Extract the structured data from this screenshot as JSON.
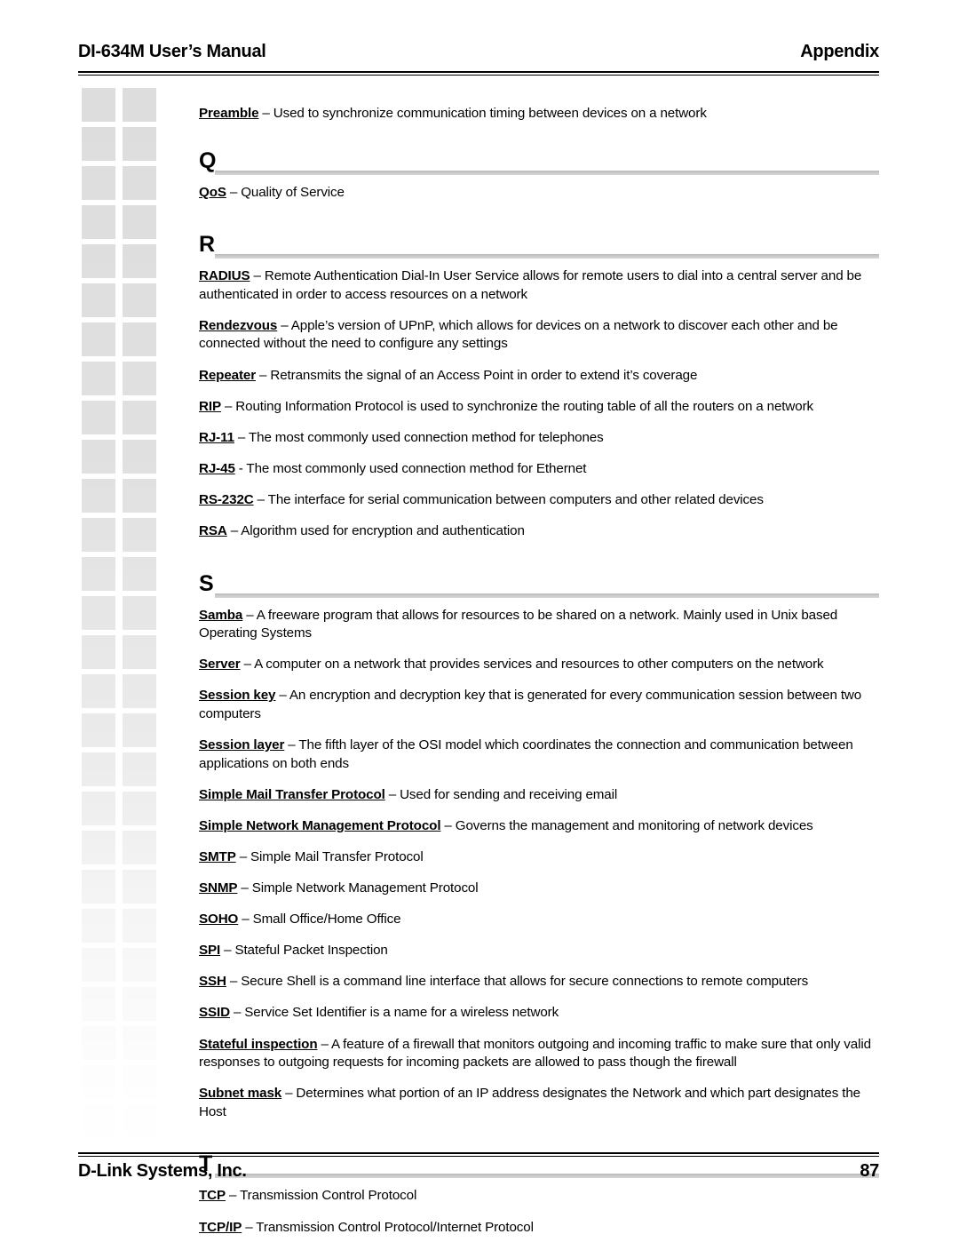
{
  "header": {
    "manual_title": "DI-634M User’s Manual",
    "section_label": "Appendix"
  },
  "footer": {
    "company": "D-Link Systems, Inc.",
    "page_number": "87"
  },
  "decoration": {
    "square_color": "#dddddd",
    "columns": 2,
    "rows": 27
  },
  "glossary": {
    "intro_entries": [
      {
        "term": "Preamble",
        "definition": " – Used to synchronize communication timing between devices on a network"
      }
    ],
    "sections": [
      {
        "letter": "Q",
        "entries": [
          {
            "term": "QoS",
            "definition": " – Quality of Service"
          }
        ]
      },
      {
        "letter": "R",
        "entries": [
          {
            "term": "RADIUS",
            "definition": " – Remote Authentication Dial-In User Service allows for remote users to dial into a central server and be authenticated in order to access resources on a network"
          },
          {
            "term": "Rendezvous",
            "definition": " – Apple’s version of UPnP, which allows for devices on a network to discover each other and be connected without the need to configure any settings"
          },
          {
            "term": "Repeater",
            "definition": " – Retransmits the signal of an Access Point in order to extend it’s coverage"
          },
          {
            "term": "RIP",
            "definition": " – Routing Information Protocol is used to synchronize the routing table of all the routers on a network"
          },
          {
            "term": "RJ-11",
            "definition": " – The most commonly used connection method for telephones"
          },
          {
            "term": "RJ-45",
            "definition": " - The most commonly used connection method for Ethernet"
          },
          {
            "term": "RS-232C",
            "definition": " – The interface for serial communication between computers and other related devices"
          },
          {
            "term": "RSA",
            "definition": " – Algorithm used for encryption and authentication"
          }
        ]
      },
      {
        "letter": "S",
        "entries": [
          {
            "term": "Samba",
            "definition": " – A freeware program that allows for resources to be shared on a network.  Mainly used in Unix based Operating Systems"
          },
          {
            "term": "Server",
            "definition": " – A computer on a network that provides services and resources to other computers on the network"
          },
          {
            "term": "Session key",
            "definition": " – An encryption and decryption key that is generated for every communication session between two computers"
          },
          {
            "term": "Session layer",
            "definition": " – The fifth layer of the OSI model which coordinates the connection and communication between applications on both ends"
          },
          {
            "term": "Simple Mail Transfer Protocol",
            "definition": " – Used for sending and receiving email"
          },
          {
            "term": "Simple Network Management Protocol",
            "definition": " – Governs the management and monitoring of network devices"
          },
          {
            "term": "SMTP",
            "definition": " – Simple Mail Transfer Protocol"
          },
          {
            "term": "SNMP",
            "definition": " – Simple Network Management Protocol"
          },
          {
            "term": "SOHO",
            "definition": " – Small Office/Home Office"
          },
          {
            "term": "SPI",
            "definition": " – Stateful Packet Inspection"
          },
          {
            "term": "SSH",
            "definition": " – Secure Shell is a command line interface that allows for secure connections to remote computers"
          },
          {
            "term": "SSID",
            "definition": " – Service Set Identifier is a name for a wireless network"
          },
          {
            "term": "Stateful inspection",
            "definition": " – A feature of a firewall that monitors outgoing and incoming traffic to make sure that only valid responses to outgoing requests for incoming packets are allowed to pass though the firewall"
          },
          {
            "term": "Subnet mask",
            "definition": " – Determines what portion of an IP address designates the Network and which part designates the Host"
          }
        ]
      },
      {
        "letter": "T",
        "entries": [
          {
            "term": "TCP",
            "definition": " – Transmission Control Protocol"
          },
          {
            "term": "TCP/IP",
            "definition": " – Transmission Control Protocol/Internet Protocol"
          }
        ]
      }
    ]
  }
}
